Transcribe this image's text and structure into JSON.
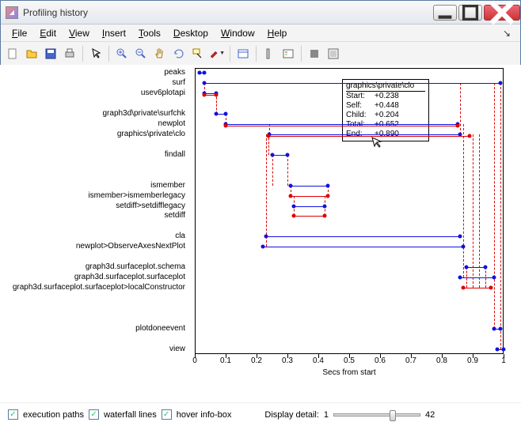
{
  "window": {
    "title": "Profiling history"
  },
  "menu": {
    "file": "File",
    "edit": "Edit",
    "view": "View",
    "insert": "Insert",
    "tools": "Tools",
    "desktop": "Desktop",
    "window": "Window",
    "help": "Help"
  },
  "chart_data": {
    "type": "waterfall-timeline",
    "xlabel": "Secs from start",
    "xlim": [
      0,
      1.0
    ],
    "xticks": [
      0,
      0.1,
      0.2,
      0.3,
      0.4,
      0.5,
      0.6,
      0.7,
      0.8,
      0.9,
      1.0
    ],
    "functions": [
      {
        "label": "peaks",
        "y": 0,
        "bars": [
          {
            "start": 0.015,
            "end": 0.03,
            "c": "blue"
          }
        ]
      },
      {
        "label": "surf",
        "y": 1,
        "bars": [
          {
            "start": 0.03,
            "end": 0.99,
            "c": "blue"
          }
        ]
      },
      {
        "label": "usev6plotapi",
        "y": 2,
        "bars": [
          {
            "start": 0.03,
            "end": 0.07,
            "c": "blue"
          },
          {
            "start": 0.03,
            "end": 0.07,
            "c": "red",
            "offset": 2
          }
        ]
      },
      {
        "label": "graph3d\\private\\surfchk",
        "y": 4,
        "bars": [
          {
            "start": 0.07,
            "end": 0.1,
            "c": "blue"
          }
        ]
      },
      {
        "label": "newplot",
        "y": 5,
        "bars": [
          {
            "start": 0.1,
            "end": 0.85,
            "c": "blue"
          },
          {
            "start": 0.1,
            "end": 0.85,
            "c": "red",
            "offset": 2
          }
        ]
      },
      {
        "label": "graphics\\private\\clo",
        "y": 6,
        "bars": [
          {
            "start": 0.24,
            "end": 0.86,
            "c": "blue"
          },
          {
            "start": 0.238,
            "end": 0.89,
            "c": "red",
            "offset": 2
          }
        ]
      },
      {
        "label": "findall",
        "y": 8,
        "bars": [
          {
            "start": 0.25,
            "end": 0.3,
            "c": "blue"
          }
        ]
      },
      {
        "label": "ismember",
        "y": 11,
        "bars": [
          {
            "start": 0.31,
            "end": 0.43,
            "c": "blue"
          }
        ]
      },
      {
        "label": "ismember>ismemberlegacy",
        "y": 12,
        "bars": [
          {
            "start": 0.31,
            "end": 0.43,
            "c": "red"
          }
        ]
      },
      {
        "label": "setdiff>setdifflegacy",
        "y": 13,
        "bars": [
          {
            "start": 0.32,
            "end": 0.42,
            "c": "blue"
          }
        ]
      },
      {
        "label": "setdiff",
        "y": 14,
        "bars": [
          {
            "start": 0.32,
            "end": 0.42,
            "c": "red"
          }
        ]
      },
      {
        "label": "cla",
        "y": 16,
        "bars": [
          {
            "start": 0.23,
            "end": 0.86,
            "c": "blue"
          }
        ]
      },
      {
        "label": "newplot>ObserveAxesNextPlot",
        "y": 17,
        "bars": [
          {
            "start": 0.22,
            "end": 0.87,
            "c": "blue"
          }
        ]
      },
      {
        "label": "graph3d.surfaceplot.schema",
        "y": 19,
        "bars": [
          {
            "start": 0.88,
            "end": 0.94,
            "c": "blue"
          }
        ]
      },
      {
        "label": "graph3d.surfaceplot.surfaceplot",
        "y": 20,
        "bars": [
          {
            "start": 0.86,
            "end": 0.97,
            "c": "blue"
          }
        ]
      },
      {
        "label": "graph3d.surfaceplot.surfaceplot>localConstructor",
        "y": 21,
        "bars": [
          {
            "start": 0.87,
            "end": 0.96,
            "c": "red"
          }
        ]
      },
      {
        "label": "plotdoneevent",
        "y": 25,
        "bars": [
          {
            "start": 0.97,
            "end": 0.99,
            "c": "blue"
          }
        ]
      },
      {
        "label": "view",
        "y": 27,
        "bars": [
          {
            "start": 0.98,
            "end": 1.0,
            "c": "blue"
          }
        ]
      }
    ],
    "vertical_paths": [
      {
        "x": 0.03,
        "y0": 1,
        "y1": 2
      },
      {
        "x": 0.07,
        "y0": 2,
        "y1": 4
      },
      {
        "x": 0.1,
        "y0": 4,
        "y1": 5
      },
      {
        "x": 0.24,
        "y0": 5,
        "y1": 6
      },
      {
        "x": 0.238,
        "y0": 6,
        "y1": 8
      },
      {
        "x": 0.25,
        "y0": 8,
        "y1": 11
      },
      {
        "x": 0.31,
        "y0": 11,
        "y1": 12
      },
      {
        "x": 0.32,
        "y0": 12,
        "y1": 14
      },
      {
        "x": 0.42,
        "y0": 14,
        "y1": 12
      },
      {
        "x": 0.43,
        "y0": 12,
        "y1": 11
      },
      {
        "x": 0.23,
        "y0": 6,
        "y1": 17
      },
      {
        "x": 0.86,
        "y0": 1,
        "y1": 6
      },
      {
        "x": 0.87,
        "y0": 5,
        "y1": 20
      },
      {
        "x": 0.88,
        "y0": 19,
        "y1": 21
      },
      {
        "x": 0.94,
        "y0": 19,
        "y1": 21
      },
      {
        "x": 0.9,
        "y0": 6,
        "y1": 21
      },
      {
        "x": 0.92,
        "y0": 6,
        "y1": 21
      },
      {
        "x": 0.97,
        "y0": 1,
        "y1": 25
      },
      {
        "x": 0.99,
        "y0": 1,
        "y1": 27
      },
      {
        "x": 0.3,
        "y0": 8,
        "y1": 11
      }
    ]
  },
  "tooltip": {
    "header": "graphics\\private\\clo",
    "rows": [
      [
        "Start:",
        "+0.238"
      ],
      [
        "Self:",
        "+0.448"
      ],
      [
        "Child:",
        "+0.204"
      ],
      [
        "Total:",
        "+0.652"
      ],
      [
        "End:",
        "+0.890"
      ]
    ]
  },
  "bottom": {
    "chk1": "execution paths",
    "chk2": "waterfall lines",
    "chk3": "hover info-box",
    "detail_label": "Display detail:",
    "detail_min": "1",
    "detail_val": "42"
  }
}
